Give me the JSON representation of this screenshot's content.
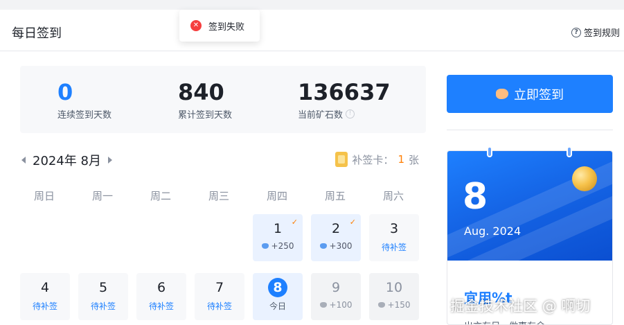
{
  "header": {
    "title": "每日签到",
    "rules_label": "签到规则"
  },
  "toast": {
    "message": "签到失败"
  },
  "stats": [
    {
      "value": "0",
      "label": "连续签到天数"
    },
    {
      "value": "840",
      "label": "累计签到天数"
    },
    {
      "value": "136637",
      "label": "当前矿石数"
    }
  ],
  "calendar": {
    "month_label": "2024年 8月",
    "makeup_card": {
      "label": "补签卡：",
      "count": "1",
      "unit": "张"
    },
    "weekdays": [
      "周日",
      "周一",
      "周二",
      "周三",
      "周四",
      "周五",
      "周六"
    ],
    "days": [
      {
        "day": "1",
        "sub": "+250",
        "status": "signed"
      },
      {
        "day": "2",
        "sub": "+300",
        "status": "signed"
      },
      {
        "day": "3",
        "sub": "待补签",
        "status": "makeup"
      },
      {
        "day": "4",
        "sub": "待补签",
        "status": "makeup"
      },
      {
        "day": "5",
        "sub": "待补签",
        "status": "makeup"
      },
      {
        "day": "6",
        "sub": "待补签",
        "status": "makeup"
      },
      {
        "day": "7",
        "sub": "待补签",
        "status": "makeup"
      },
      {
        "day": "8",
        "sub": "今日",
        "status": "today"
      },
      {
        "day": "9",
        "sub": "+100",
        "status": "future"
      },
      {
        "day": "10",
        "sub": "+150",
        "status": "future"
      }
    ]
  },
  "signin": {
    "button_label": "立即签到"
  },
  "card": {
    "day": "8",
    "month": "Aug. 2024",
    "quote": "宜用%t",
    "sub": "出言有尺，做事有余"
  },
  "watermark": "掘金技术社区 @ 啊切",
  "colors": {
    "accent": "#1e80ff",
    "error": "#f53f3f",
    "warning": "#ff7d00"
  }
}
